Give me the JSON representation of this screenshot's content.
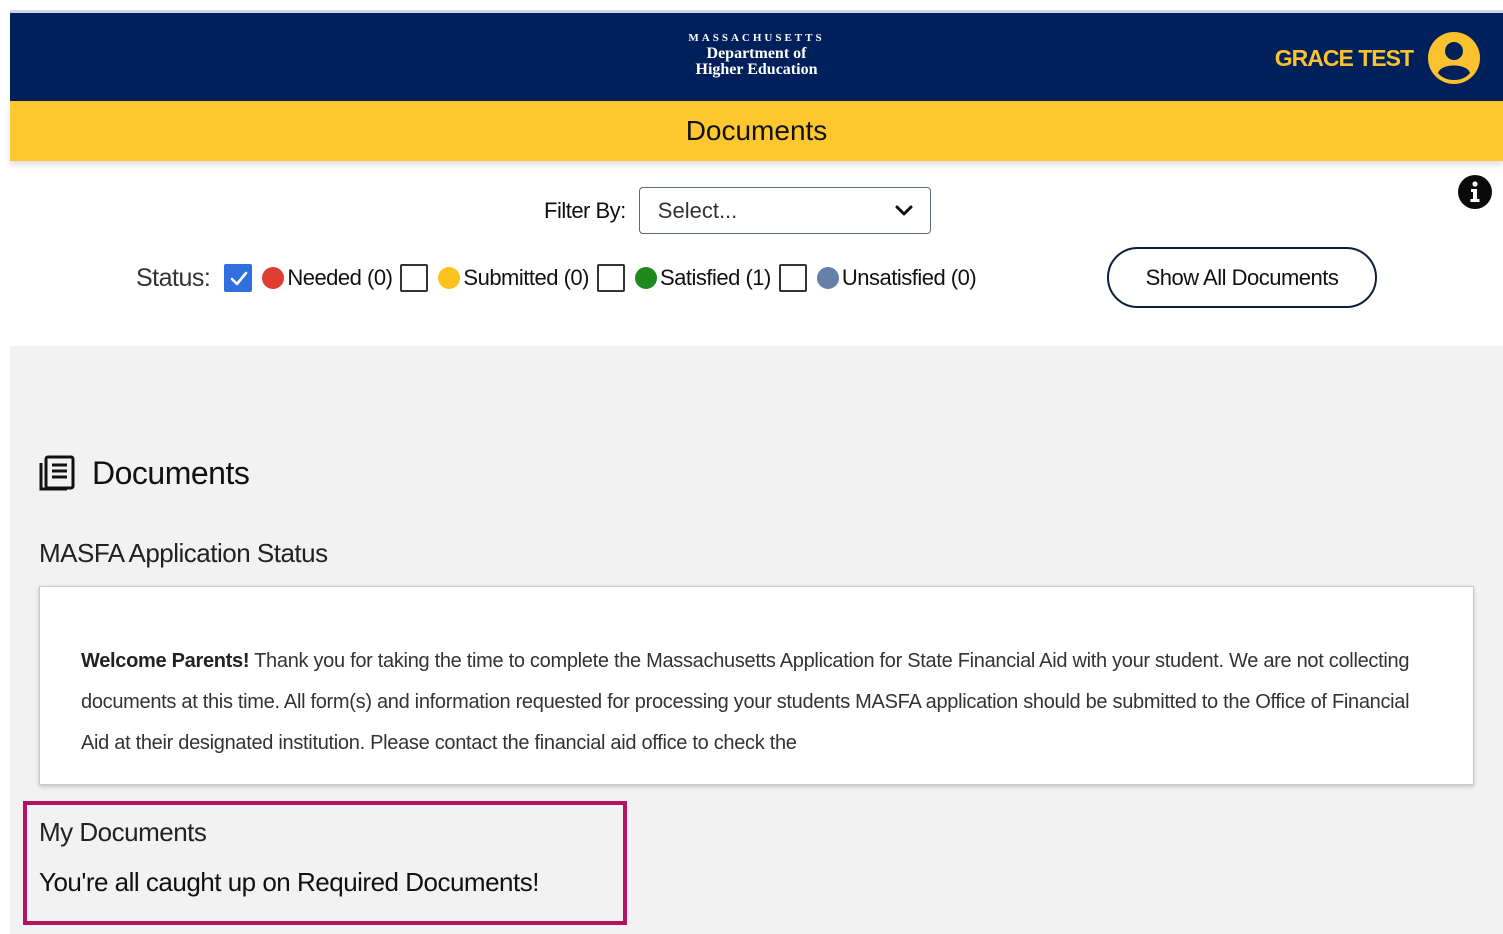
{
  "header": {
    "logo_line1": "MASSACHUSETTS",
    "logo_line2": "Department of",
    "logo_line3": "Higher Education",
    "user_name": "GRACE TEST",
    "colors": {
      "navy": "#00205b",
      "gold": "#f9c22e"
    }
  },
  "title_bar": {
    "title": "Documents",
    "color": "#fdc82f"
  },
  "filter": {
    "label": "Filter By:",
    "select_value": "Select..."
  },
  "status": {
    "label": "Status:",
    "items": [
      {
        "label": "Needed (0)",
        "checked": true,
        "color": "#e03c31"
      },
      {
        "label": "Submitted (0)",
        "checked": false,
        "color": "#fdc21d"
      },
      {
        "label": "Satisfied (1)",
        "checked": false,
        "color": "#1e8a1e"
      },
      {
        "label": "Unsatisfied (0)",
        "checked": false,
        "color": "#6680a8"
      }
    ]
  },
  "show_all_button": "Show All Documents",
  "main": {
    "heading": "Documents",
    "masfa_title": "MASFA Application Status",
    "notice_bold": "Welcome Parents!",
    "notice_text": " Thank you for taking the time to complete the Massachusetts Application for State Financial Aid with your student. We are not collecting documents at this time. All form(s) and information requested for processing your students MASFA application should be submitted to the Office of Financial Aid at their designated institution. Please contact the financial aid office to check the",
    "my_documents_title": "My Documents",
    "my_documents_message": "You're all caught up on Required Documents!",
    "highlight_color": "#b3135e"
  }
}
